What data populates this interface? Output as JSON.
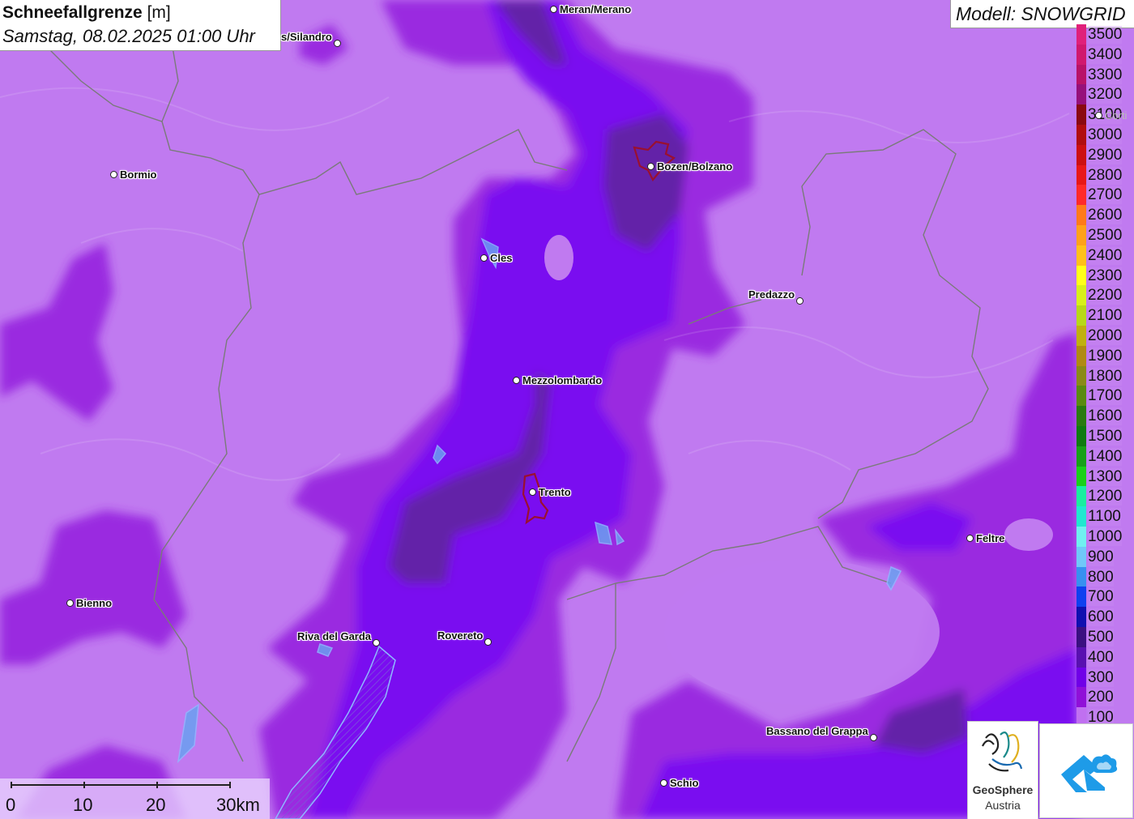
{
  "title": {
    "main": "Schneefallgrenze",
    "unit": "[m]",
    "datetime": "Samstag, 08.02.2025 01:00 Uhr"
  },
  "model": {
    "label": "Modell: SNOWGRID"
  },
  "legend": {
    "items": [
      {
        "label": "3500",
        "color": "#e0207a"
      },
      {
        "label": "3400",
        "color": "#d0186e"
      },
      {
        "label": "3300",
        "color": "#b81268"
      },
      {
        "label": "3200",
        "color": "#96107a"
      },
      {
        "label": "3100",
        "color": "#8a0a10"
      },
      {
        "label": "3000",
        "color": "#b00e0e"
      },
      {
        "label": "2900",
        "color": "#cc1010"
      },
      {
        "label": "2800",
        "color": "#e81818"
      },
      {
        "label": "2700",
        "color": "#ff2a2a"
      },
      {
        "label": "2600",
        "color": "#ff7a1a"
      },
      {
        "label": "2500",
        "color": "#ffa11a"
      },
      {
        "label": "2400",
        "color": "#ffc01a"
      },
      {
        "label": "2300",
        "color": "#ffff1a"
      },
      {
        "label": "2200",
        "color": "#d8f01a"
      },
      {
        "label": "2100",
        "color": "#b8d818"
      },
      {
        "label": "2000",
        "color": "#c0b010"
      },
      {
        "label": "1900",
        "color": "#b08a14"
      },
      {
        "label": "1800",
        "color": "#8a8a18"
      },
      {
        "label": "1700",
        "color": "#5a8a10"
      },
      {
        "label": "1600",
        "color": "#2a7a10"
      },
      {
        "label": "1500",
        "color": "#107a10"
      },
      {
        "label": "1400",
        "color": "#18a018"
      },
      {
        "label": "1300",
        "color": "#1ad01a"
      },
      {
        "label": "1200",
        "color": "#1aeea0"
      },
      {
        "label": "1100",
        "color": "#20e8d0"
      },
      {
        "label": "1000",
        "color": "#70f0f0"
      },
      {
        "label": "900",
        "color": "#70c8f8"
      },
      {
        "label": "800",
        "color": "#3890f0"
      },
      {
        "label": "700",
        "color": "#1040f0"
      },
      {
        "label": "600",
        "color": "#1010b0"
      },
      {
        "label": "500",
        "color": "#3a1080"
      },
      {
        "label": "400",
        "color": "#5810b0"
      },
      {
        "label": "300",
        "color": "#7000e8"
      },
      {
        "label": "200",
        "color": "#9010d8"
      },
      {
        "label": "100",
        "color": "#c070f0"
      }
    ]
  },
  "cities": [
    {
      "id": "meran",
      "label": "Meran/Merano"
    },
    {
      "id": "silandro",
      "label": "s/Silandro"
    },
    {
      "id": "bozen",
      "label": "Bozen/Bolzano"
    },
    {
      "id": "bormio",
      "label": "Bormio"
    },
    {
      "id": "cles",
      "label": "Cles"
    },
    {
      "id": "predazzo",
      "label": "Predazzo"
    },
    {
      "id": "mezzolombardo",
      "label": "Mezzolombardo"
    },
    {
      "id": "trento",
      "label": "Trento"
    },
    {
      "id": "feltre",
      "label": "Feltre"
    },
    {
      "id": "bienno",
      "label": "Bienno"
    },
    {
      "id": "riva",
      "label": "Riva del Garda"
    },
    {
      "id": "rovereto",
      "label": "Rovereto"
    },
    {
      "id": "bassano",
      "label": "Bassano del Grappa"
    },
    {
      "id": "schio",
      "label": "Schio"
    },
    {
      "id": "cortina",
      "label": "Corti"
    }
  ],
  "scalebar": {
    "labels": [
      "0",
      "10",
      "20",
      "30km"
    ]
  },
  "logos": {
    "geosphere_line1": "GeoSphere",
    "geosphere_line2": "Austria"
  },
  "icons": {
    "map_terrain": "snowfall-limit-map",
    "logo1": "geosphere-logo-icon",
    "logo2": "house-cloud-logo-icon"
  }
}
